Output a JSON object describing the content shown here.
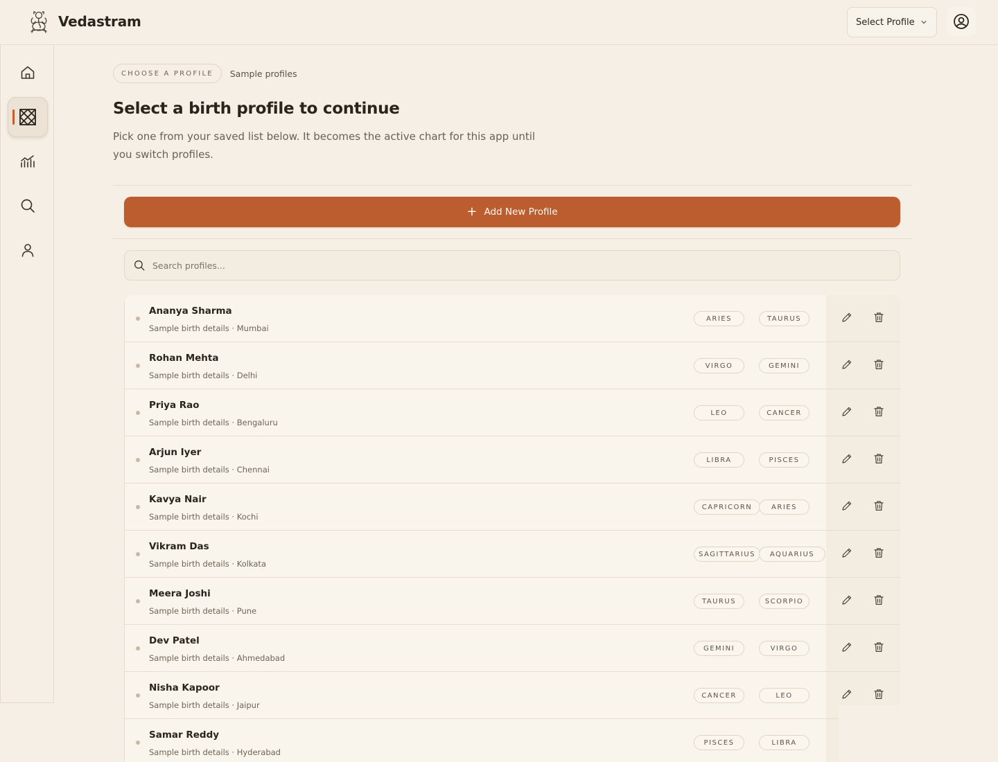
{
  "header": {
    "brand": "Vedastram",
    "select_profile_label": "Select Profile"
  },
  "sidebar": {
    "items": [
      {
        "name": "home",
        "icon": "home-icon"
      },
      {
        "name": "chart",
        "icon": "chart-grid-icon",
        "active": true
      },
      {
        "name": "analytics",
        "icon": "trend-chart-icon"
      },
      {
        "name": "search",
        "icon": "search-icon"
      },
      {
        "name": "profile",
        "icon": "user-icon"
      }
    ]
  },
  "main": {
    "breadcrumb_pill": "CHOOSE A PROFILE",
    "breadcrumb_text": "Sample profiles",
    "title": "Select a birth profile to continue",
    "subtitle": "Pick one from your saved list below. It becomes the active chart for this app until you switch profiles.",
    "add_button": "Add New Profile",
    "search_placeholder": "Search profiles..."
  },
  "colors": {
    "accent": "#bb5d2e",
    "background": "#f5efe5"
  },
  "profiles": [
    {
      "name": "Ananya Sharma",
      "details": "Sample birth details · Mumbai",
      "sign1": "ARIES",
      "sign2": "TAURUS"
    },
    {
      "name": "Rohan Mehta",
      "details": "Sample birth details · Delhi",
      "sign1": "VIRGO",
      "sign2": "GEMINI"
    },
    {
      "name": "Priya Rao",
      "details": "Sample birth details · Bengaluru",
      "sign1": "LEO",
      "sign2": "CANCER"
    },
    {
      "name": "Arjun Iyer",
      "details": "Sample birth details · Chennai",
      "sign1": "LIBRA",
      "sign2": "PISCES"
    },
    {
      "name": "Kavya Nair",
      "details": "Sample birth details · Kochi",
      "sign1": "CAPRICORN",
      "sign2": "ARIES"
    },
    {
      "name": "Vikram Das",
      "details": "Sample birth details · Kolkata",
      "sign1": "SAGITTARIUS",
      "sign2": "AQUARIUS"
    },
    {
      "name": "Meera Joshi",
      "details": "Sample birth details · Pune",
      "sign1": "TAURUS",
      "sign2": "SCORPIO"
    },
    {
      "name": "Dev Patel",
      "details": "Sample birth details · Ahmedabad",
      "sign1": "GEMINI",
      "sign2": "VIRGO"
    },
    {
      "name": "Nisha Kapoor",
      "details": "Sample birth details · Jaipur",
      "sign1": "CANCER",
      "sign2": "LEO"
    },
    {
      "name": "Samar Reddy",
      "details": "Sample birth details · Hyderabad",
      "sign1": "PISCES",
      "sign2": "LIBRA"
    }
  ]
}
